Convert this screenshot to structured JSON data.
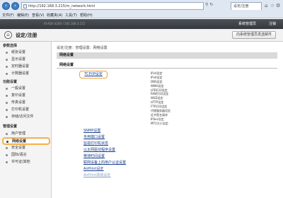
{
  "browser": {
    "url": "http://192.168.3.215/m_network.html",
    "tab_title": "设定/注册",
    "menu": [
      "文件(F)",
      "编辑(E)",
      "查看(V)",
      "收藏夹(A)",
      "工具(T)",
      "帮助(H)"
    ],
    "back_icon": "back-arrow",
    "forward_icon": "forward-arrow"
  },
  "header": {
    "device_meta": "iR-ADV 4200 / 192.168.3.215",
    "user": "系统管理员",
    "logout": "注销",
    "page_title": "设定/注册",
    "mail_button": "向系统管理员发送邮件"
  },
  "sidebar": {
    "sections": [
      {
        "title": "参数选择",
        "items": [
          "纸张设置",
          "显示设置",
          "定时器设置",
          "计数器设置"
        ]
      },
      {
        "title": "功能设置",
        "items": [
          "一般设置",
          "复印设置",
          "传真设置",
          "打印机设置",
          "存储/访问文件"
        ]
      },
      {
        "title": "管理设置",
        "items": [
          "用户管理",
          "网络设置",
          "安全设置",
          "国际/语言",
          "许可证/其他"
        ]
      }
    ],
    "active_item": "网络设置"
  },
  "main": {
    "breadcrumb": "设定/注册：管理设置：网络设置",
    "section_title": "网络设置",
    "subsection_title": "网络设置",
    "tcp_link": "TCP/IP设定",
    "tcp_sub_items": [
      "IPv4设定",
      "IPv6设定",
      "DNS设定",
      "WINS设定",
      "LPD打印设定",
      "RAW打印设定",
      "WSD设定",
      "HTTP设定",
      "FTP打印设定",
      "代理服务器设定",
      "证书签名请求",
      "IPSec设定",
      "MTU大小设定"
    ],
    "links": [
      "SNMP设置",
      "专用端口设置",
      "监视打印机状态",
      "以太网驱动程序设置",
      "等待时间设置",
      "联网设备上的用户认证设置",
      "AirPrint设定",
      "AirPrint高级设定"
    ]
  }
}
